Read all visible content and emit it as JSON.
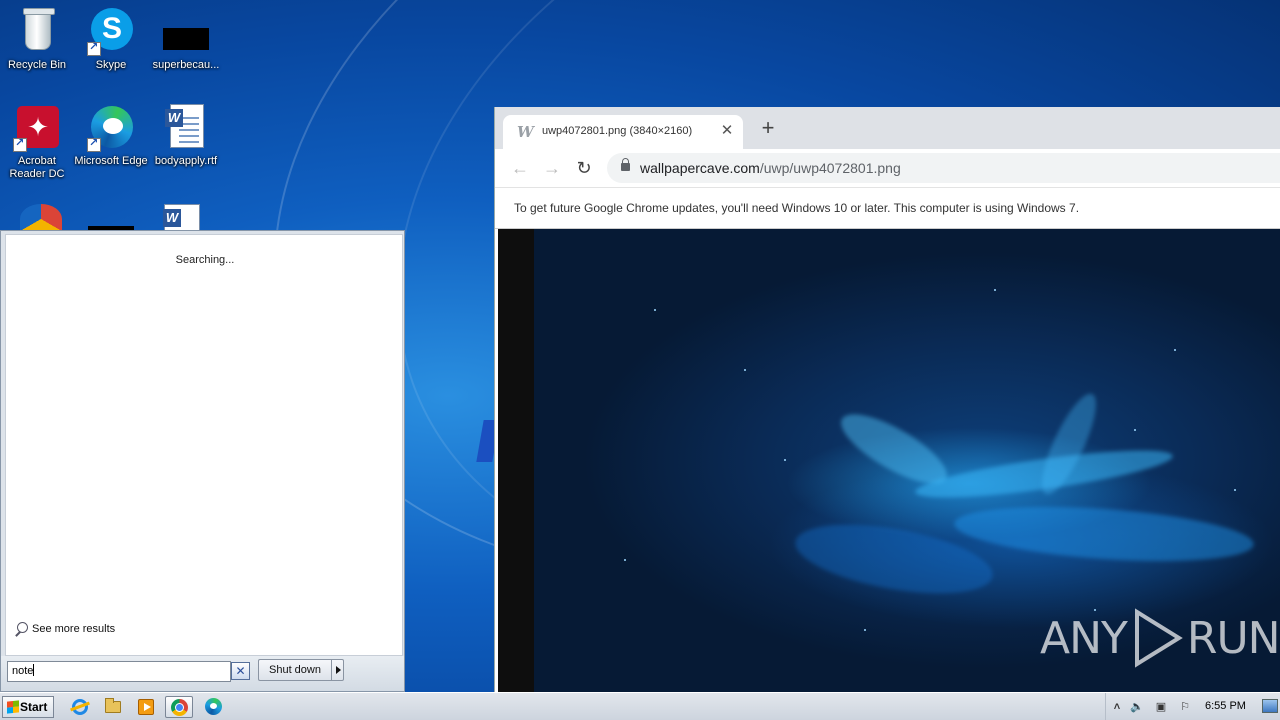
{
  "desktop": {
    "icons": [
      {
        "label": "Recycle Bin",
        "icon": "recycle-bin-icon"
      },
      {
        "label": "Skype",
        "icon": "skype-icon"
      },
      {
        "label": "superbecau...",
        "icon": "file-thumbnail-icon"
      },
      {
        "label": "Acrobat Reader DC",
        "icon": "acrobat-icon"
      },
      {
        "label": "Microsoft Edge",
        "icon": "edge-icon"
      },
      {
        "label": "bodyapply.rtf",
        "icon": "word-doc-icon"
      }
    ]
  },
  "start_menu": {
    "status_text": "Searching...",
    "see_more": "See more results",
    "search_value": "note",
    "shutdown_label": "Shut down"
  },
  "chrome": {
    "tab_title": "uwp4072801.png (3840×2160)",
    "url_host": "wallpapercave.com",
    "url_path": "/uwp/uwp4072801.png",
    "infobar_text": "To get future Google Chrome updates, you'll need Windows 10 or later. This computer is using Windows 7."
  },
  "watermark": {
    "left": "ANY",
    "right": "RUN"
  },
  "taskbar": {
    "start_label": "Start",
    "pinned": [
      "internet-explorer-icon",
      "file-explorer-icon",
      "media-player-icon",
      "chrome-icon",
      "edge-icon"
    ],
    "active_app": "chrome-icon",
    "clock": "6:55 PM"
  }
}
